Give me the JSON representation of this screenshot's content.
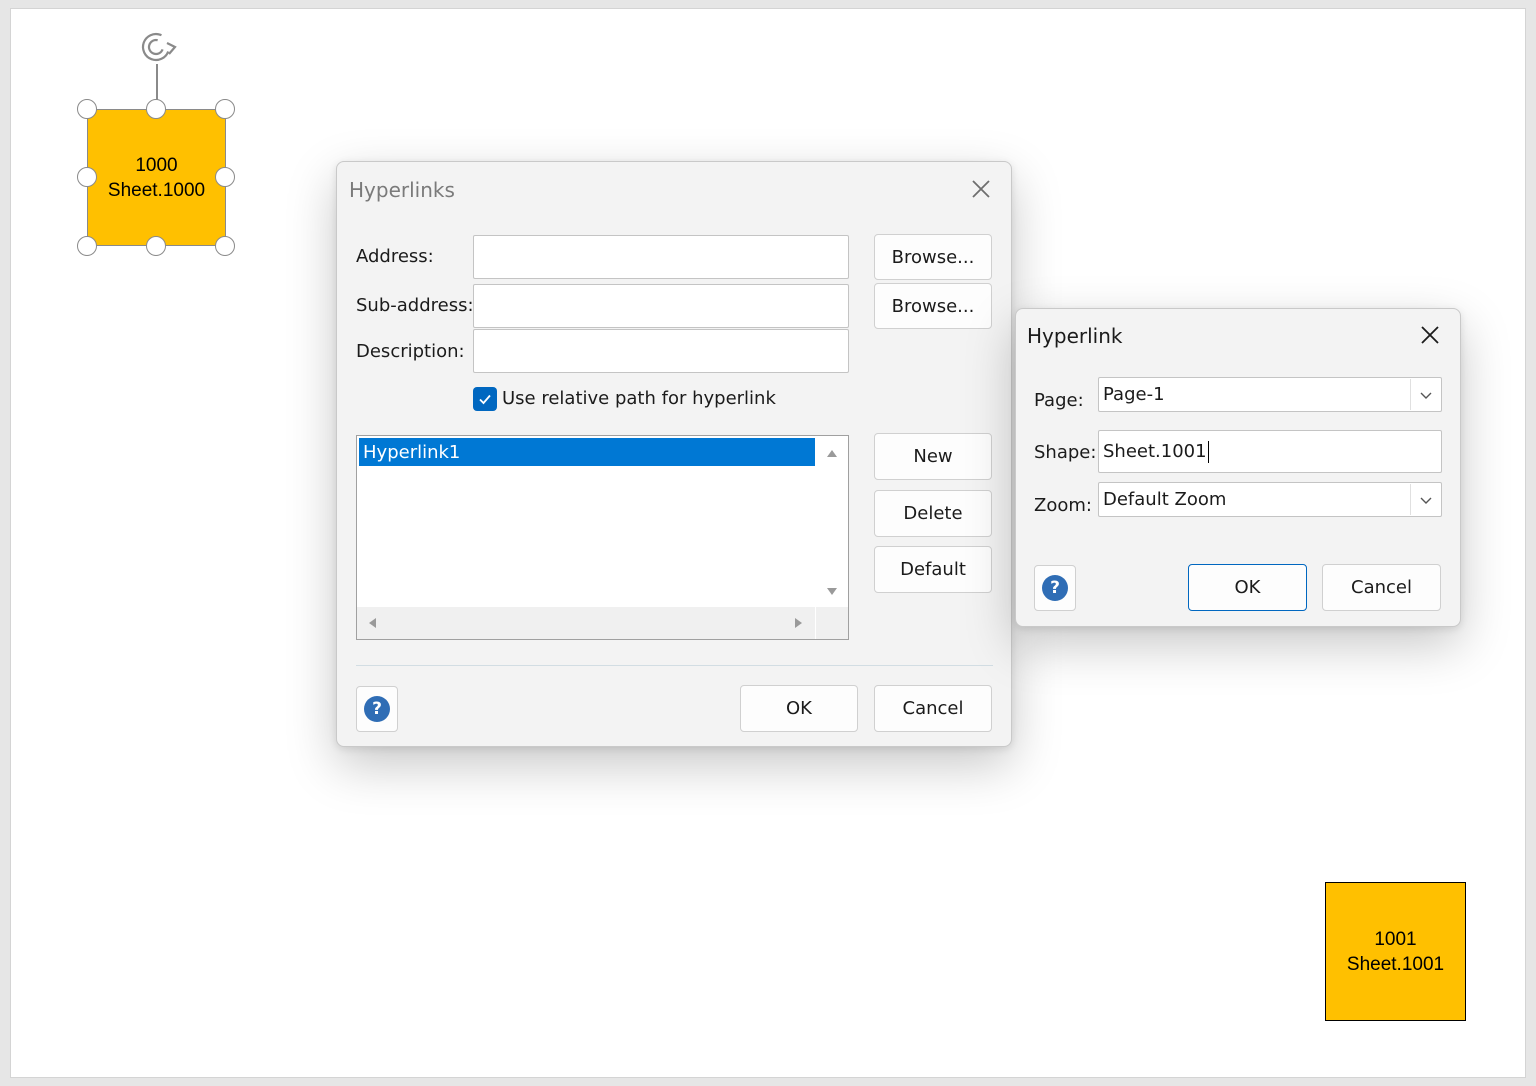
{
  "shapes": {
    "shape_1000": {
      "line1": "1000",
      "line2": "Sheet.1000"
    },
    "shape_1001": {
      "line1": "1001",
      "line2": "Sheet.1001"
    },
    "fill_color": "#ffc000"
  },
  "hyperlinks_dialog": {
    "title": "Hyperlinks",
    "address_label": "Address:",
    "address_value": "",
    "subaddress_label": "Sub-address:",
    "subaddress_value": "",
    "description_label": "Description:",
    "description_value": "",
    "browse_label": "Browse...",
    "browse2_label": "Browse...",
    "relative_path_label": "Use relative path for hyperlink",
    "relative_path_checked": true,
    "list_items": [
      "Hyperlink1"
    ],
    "new_label": "New",
    "delete_label": "Delete",
    "default_label": "Default",
    "ok_label": "OK",
    "cancel_label": "Cancel"
  },
  "hyperlink_dialog": {
    "title": "Hyperlink",
    "page_label": "Page:",
    "page_value": "Page-1",
    "shape_label": "Shape:",
    "shape_value": "Sheet.1001",
    "zoom_label": "Zoom:",
    "zoom_value": "Default Zoom",
    "ok_label": "OK",
    "cancel_label": "Cancel"
  },
  "icons": {
    "help": "help-icon",
    "close": "close-icon",
    "check": "checkmark-icon",
    "dropdown": "chevron-down-icon",
    "rotate": "rotate-icon"
  },
  "colors": {
    "accent": "#0067c0",
    "selection": "#0078d4",
    "help": "#2f6db5"
  }
}
